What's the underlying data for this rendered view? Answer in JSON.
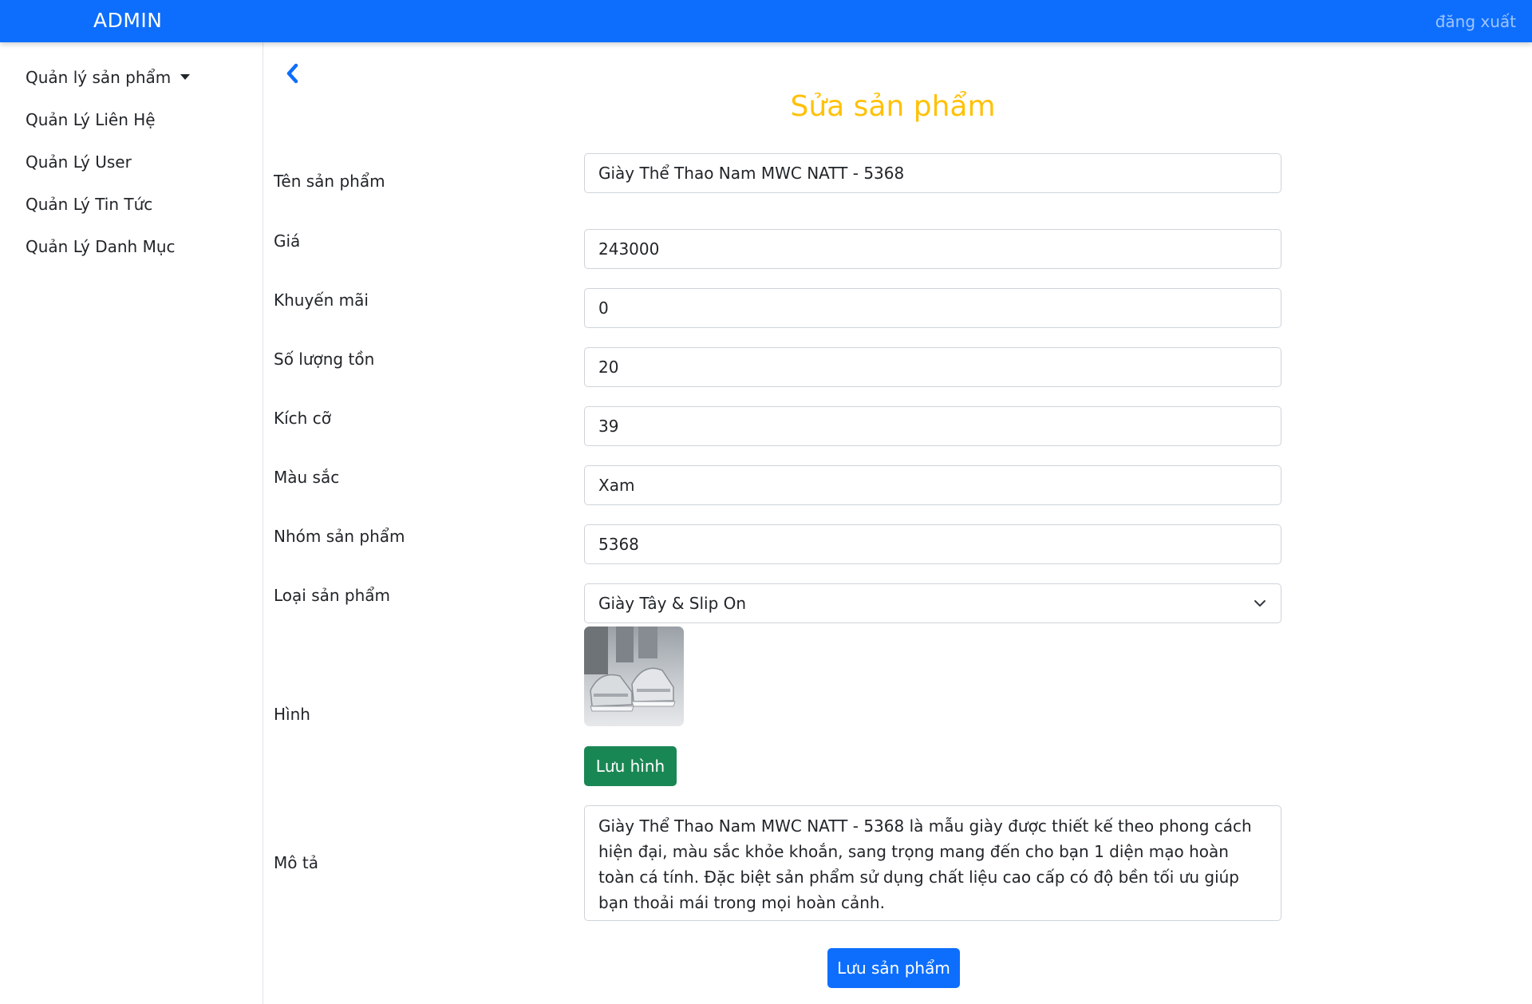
{
  "header": {
    "brand": "ADMIN",
    "logout": "đăng xuất"
  },
  "sidebar": {
    "items": [
      {
        "label": "Quản lý sản phẩm"
      },
      {
        "label": "Quản Lý Liên Hệ"
      },
      {
        "label": "Quản Lý User"
      },
      {
        "label": "Quản Lý Tin Tức"
      },
      {
        "label": "Quản Lý Danh Mục"
      }
    ]
  },
  "page": {
    "title": "Sửa sản phẩm"
  },
  "form": {
    "name": {
      "label": "Tên sản phẩm",
      "value": "Giày Thể Thao Nam MWC NATT - 5368"
    },
    "price": {
      "label": "Giá",
      "value": "243000"
    },
    "discount": {
      "label": "Khuyến mãi",
      "value": "0"
    },
    "stock": {
      "label": "Số lượng tồn",
      "value": "20"
    },
    "size": {
      "label": "Kích cỡ",
      "value": "39"
    },
    "color": {
      "label": "Màu sắc",
      "value": "Xam"
    },
    "group": {
      "label": "Nhóm sản phẩm",
      "value": "5368"
    },
    "category": {
      "label": "Loại sản phẩm",
      "value": "Giày Tây & Slip On"
    },
    "image": {
      "label": "Hình",
      "save_label": "Lưu hình"
    },
    "description": {
      "label": "Mô tả",
      "value": "Giày Thể Thao Nam MWC NATT - 5368 là mẫu giày được thiết kế theo phong cách hiện đại, màu sắc khỏe khoắn, sang trọng mang đến cho bạn 1 diện mạo hoàn toàn cá tính. Đặc biệt sản phẩm sử dụng chất liệu cao cấp có độ bền tối ưu giúp bạn thoải mái trong mọi hoàn cảnh."
    },
    "submit_label": "Lưu sản phẩm"
  },
  "colors": {
    "navbar": "#0d6efd",
    "title": "#ffc107",
    "save_image_button": "#198754",
    "submit_button": "#0d6efd"
  },
  "icons": {
    "back": "chevron-left-icon",
    "dropdown": "caret-down-icon",
    "select": "chevron-down-icon"
  }
}
